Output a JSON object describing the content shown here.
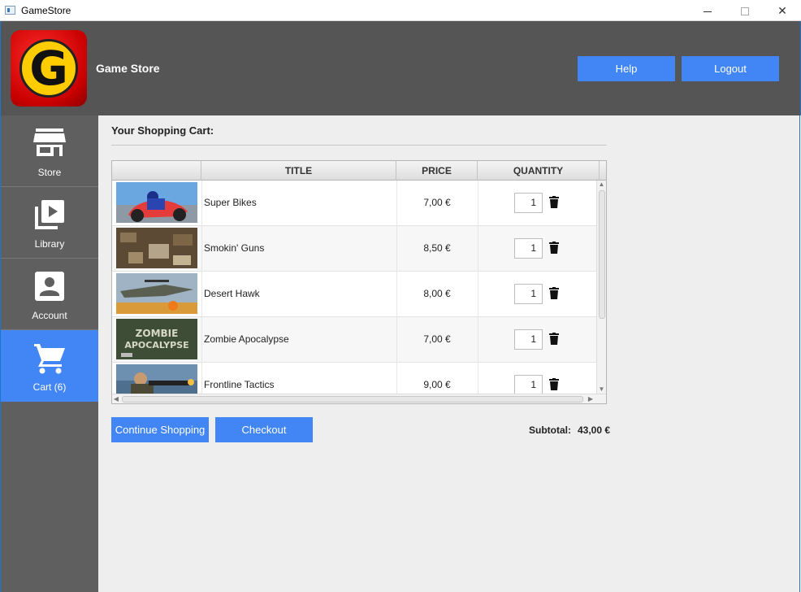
{
  "window": {
    "title": "GameStore"
  },
  "header": {
    "app_name": "Game Store",
    "logo_letter": "G",
    "help_label": "Help",
    "logout_label": "Logout"
  },
  "sidebar": {
    "items": [
      {
        "label": "Store",
        "icon": "store-icon"
      },
      {
        "label": "Library",
        "icon": "library-icon"
      },
      {
        "label": "Account",
        "icon": "account-icon"
      },
      {
        "label": "Cart (6)",
        "icon": "cart-icon",
        "active": true
      }
    ]
  },
  "cart": {
    "title": "Your Shopping Cart:",
    "columns": [
      "TITLE",
      "PRICE",
      "QUANTITY"
    ],
    "rows": [
      {
        "title": "Super Bikes",
        "price": "7,00 €",
        "quantity": "1"
      },
      {
        "title": "Smokin' Guns",
        "price": "8,50 €",
        "quantity": "1"
      },
      {
        "title": "Desert Hawk",
        "price": "8,00 €",
        "quantity": "1"
      },
      {
        "title": "Zombie Apocalypse",
        "price": "7,00 €",
        "quantity": "1",
        "cover_text": "ZOMBIE APOCALYPSE"
      },
      {
        "title": "Frontline Tactics",
        "price": "9,00 €",
        "quantity": "1"
      }
    ],
    "continue_label": "Continue Shopping",
    "checkout_label": "Checkout",
    "subtotal_label": "Subtotal:",
    "subtotal_value": "43,00 €"
  },
  "colors": {
    "accent": "#4285f4",
    "header_bg": "#555555",
    "sidebar_bg": "#5f5f5f",
    "main_bg": "#eeeeee"
  }
}
